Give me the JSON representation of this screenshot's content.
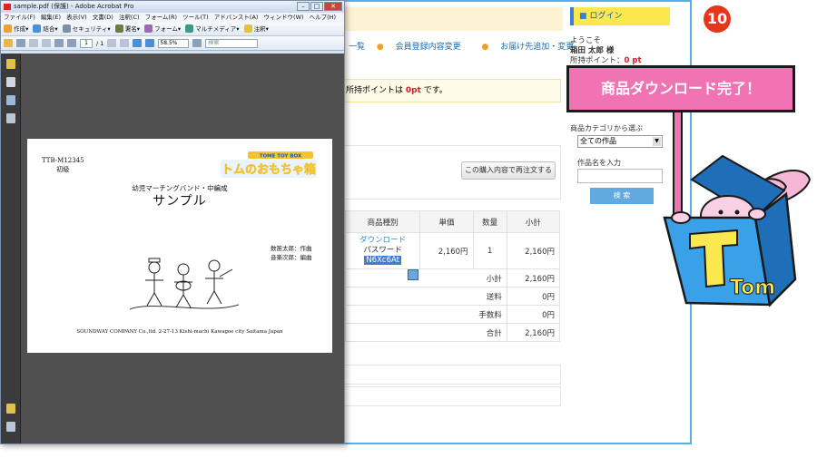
{
  "step_badge": "10",
  "callout_text": "商品ダウンロード完了！",
  "website": {
    "nav": [
      "一覧",
      "会員登録内容変更",
      "お届け先追加・変更"
    ],
    "points_notice": {
      "prefix": "所持ポイントは",
      "value": "0pt",
      "suffix": "です。"
    },
    "reorder_button": "この購入内容で再注文する",
    "order_table": {
      "headers": [
        "商品種別",
        "単価",
        "数量",
        "小計"
      ],
      "row": {
        "download_label": "ダウンロード",
        "password_label": "パスワード",
        "password_value": "N6Xc6At",
        "unit_price": "2,160円",
        "quantity": "1",
        "subtotal": "2,160円"
      },
      "summary": [
        {
          "label": "小計",
          "value": "2,160円"
        },
        {
          "label": "送料",
          "value": "0円"
        },
        {
          "label": "手数料",
          "value": "0円"
        },
        {
          "label": "合計",
          "value": "2,160円"
        }
      ]
    }
  },
  "sidebar": {
    "login_title": "ログイン",
    "welcome": "ようこそ",
    "user_name": "箱田 太郎 様",
    "points_label": "所持ポイント：",
    "points_value": "0 pt",
    "category_label": "商品カテゴリから選ぶ",
    "category_selected": "全ての作品",
    "name_label": "作品名を入力",
    "search_button": "検 索"
  },
  "acrobat": {
    "window_title": "sample.pdf (保護) - Adobe Acrobat Pro",
    "menu": [
      "ファイル(F)",
      "編集(E)",
      "表示(V)",
      "文書(D)",
      "注釈(C)",
      "フォーム(R)",
      "ツール(T)",
      "アドバンスト(A)",
      "ウィンドウ(W)",
      "ヘルプ(H)"
    ],
    "toolbar": [
      "作成",
      "結合",
      "セキュリティ",
      "署名",
      "フォーム",
      "マルチメディア",
      "注釈"
    ],
    "page_current": "1",
    "page_total": "/ 1",
    "zoom": "58.5%",
    "search_placeholder": "検索"
  },
  "pdf": {
    "code_line1": "TTB-M12345",
    "code_line2": "初級",
    "logo_top": "TOME TOY BOX",
    "logo_main": "トムのおもちゃ箱",
    "ensemble": "幼児マーチングバンド・中編成",
    "title": "サンプル",
    "credit1": "数笛太郎：作曲",
    "credit2": "音楽次郎：編曲",
    "publisher": "SOUNDWAY COMPANY Co.,ltd. 2-27-13 Kishi-machi Kawagoe city Saitama Japan"
  },
  "mascot_text": "Tom",
  "colors": {
    "callout_bg": "#f074b4",
    "badge_red": "#e8341b",
    "site_border": "#5aaee6",
    "login_yellow": "#fbe84e",
    "price_red": "#e0192c",
    "box_blue": "#3aa1e8"
  }
}
